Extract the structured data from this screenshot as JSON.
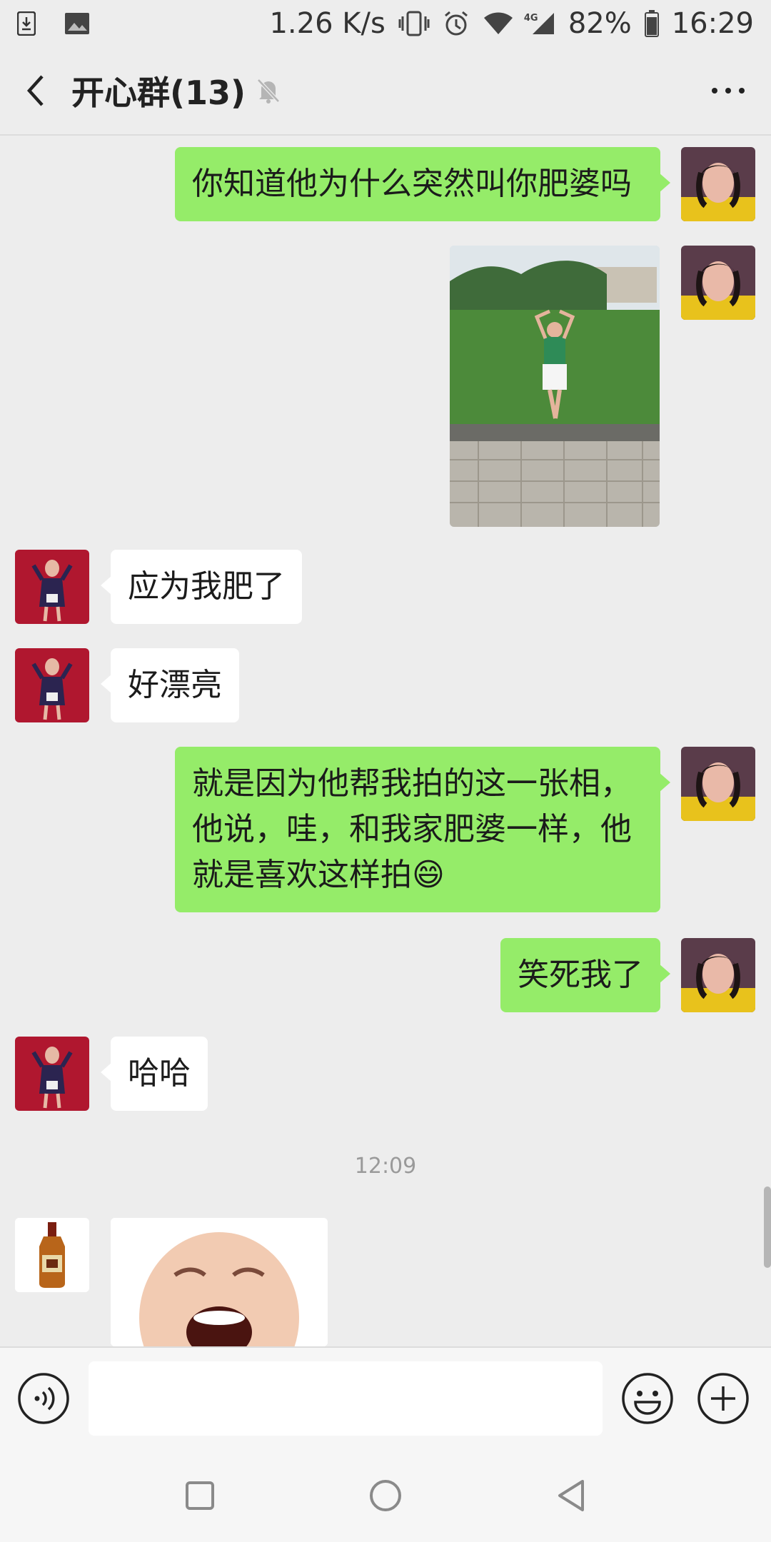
{
  "status_bar": {
    "speed": "1.26 K/s",
    "network": "4G",
    "battery": "82%",
    "time": "16:29",
    "icons": [
      "download-icon",
      "gallery-icon",
      "vibrate-icon",
      "alarm-icon",
      "wifi-icon",
      "signal-icon",
      "battery-icon"
    ]
  },
  "header": {
    "title": "开心群(13)",
    "icons": [
      "back-arrow-icon",
      "mute-bell-icon",
      "more-dots-icon"
    ]
  },
  "messages": [
    {
      "sender": "me",
      "type": "text",
      "text": "你知道他为什么突然叫你肥婆吗"
    },
    {
      "sender": "me",
      "type": "image",
      "description_icon": "photo"
    },
    {
      "sender": "other",
      "type": "text",
      "text": "应为我肥了"
    },
    {
      "sender": "other",
      "type": "text",
      "text": "好漂亮"
    },
    {
      "sender": "me",
      "type": "text",
      "lines": [
        "就是因为他帮我拍的这一张相，",
        "他说，哇，和我家肥婆一样，他",
        "就是喜欢这样拍"
      ],
      "emoji": "😄"
    },
    {
      "sender": "me",
      "type": "text",
      "text": "笑死我了"
    },
    {
      "sender": "other",
      "type": "text",
      "text": "哈哈"
    },
    {
      "sender": "other2",
      "type": "sticker"
    }
  ],
  "timestamp": "12:09",
  "input_bar": {
    "value": "",
    "icons": [
      "voice-icon",
      "emoji-icon",
      "plus-icon"
    ]
  },
  "nav_bar": {
    "icons": [
      "recents-icon",
      "home-icon",
      "back-nav-icon"
    ]
  },
  "colors": {
    "background": "#ededed",
    "my_bubble": "#95ec69",
    "other_bubble": "#ffffff"
  }
}
